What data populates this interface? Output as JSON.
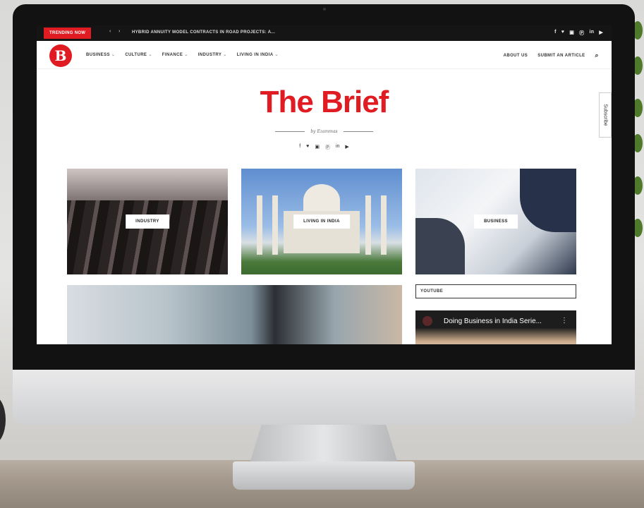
{
  "topbar": {
    "badge": "TRENDING NOW",
    "prev_icon": "‹",
    "next_icon": "›",
    "headline": "HYBRID ANNUITY MODEL CONTRACTS IN ROAD PROJECTS: A...",
    "social_icons": [
      "facebook-icon",
      "twitter-icon",
      "instagram-icon",
      "pinterest-icon",
      "linkedin-icon",
      "youtube-icon"
    ],
    "social_glyphs": [
      "f",
      "♥",
      "▣",
      "Ⓟ",
      "in",
      "▶"
    ]
  },
  "nav": {
    "logo": "B",
    "menu": [
      {
        "label": "BUSINESS",
        "caret": "⌄"
      },
      {
        "label": "CULTURE",
        "caret": "⌄"
      },
      {
        "label": "FINANCE",
        "caret": "⌄"
      },
      {
        "label": "INDUSTRY",
        "caret": "⌄"
      },
      {
        "label": "LIVING IN INDIA",
        "caret": "⌄"
      }
    ],
    "about": "ABOUT US",
    "submit": "SUBMIT AN ARTICLE",
    "search_glyph": "⌕"
  },
  "subscribe": "Subscribe",
  "header": {
    "title": "The Brief",
    "byline": "by Ezammas",
    "social_glyphs": [
      "f",
      "♥",
      "▣",
      "Ⓟ",
      "in",
      "▶"
    ]
  },
  "tiles": {
    "industry": "INDUSTRY",
    "india": "LIVING IN INDIA",
    "business": "BUSINESS"
  },
  "sidebar": {
    "youtube_label": "YOUTUBE",
    "video_title": "Doing Business in India Serie...",
    "video_menu": "⋮"
  },
  "colors": {
    "brand_red": "#e01b22",
    "topbar": "#151515"
  }
}
